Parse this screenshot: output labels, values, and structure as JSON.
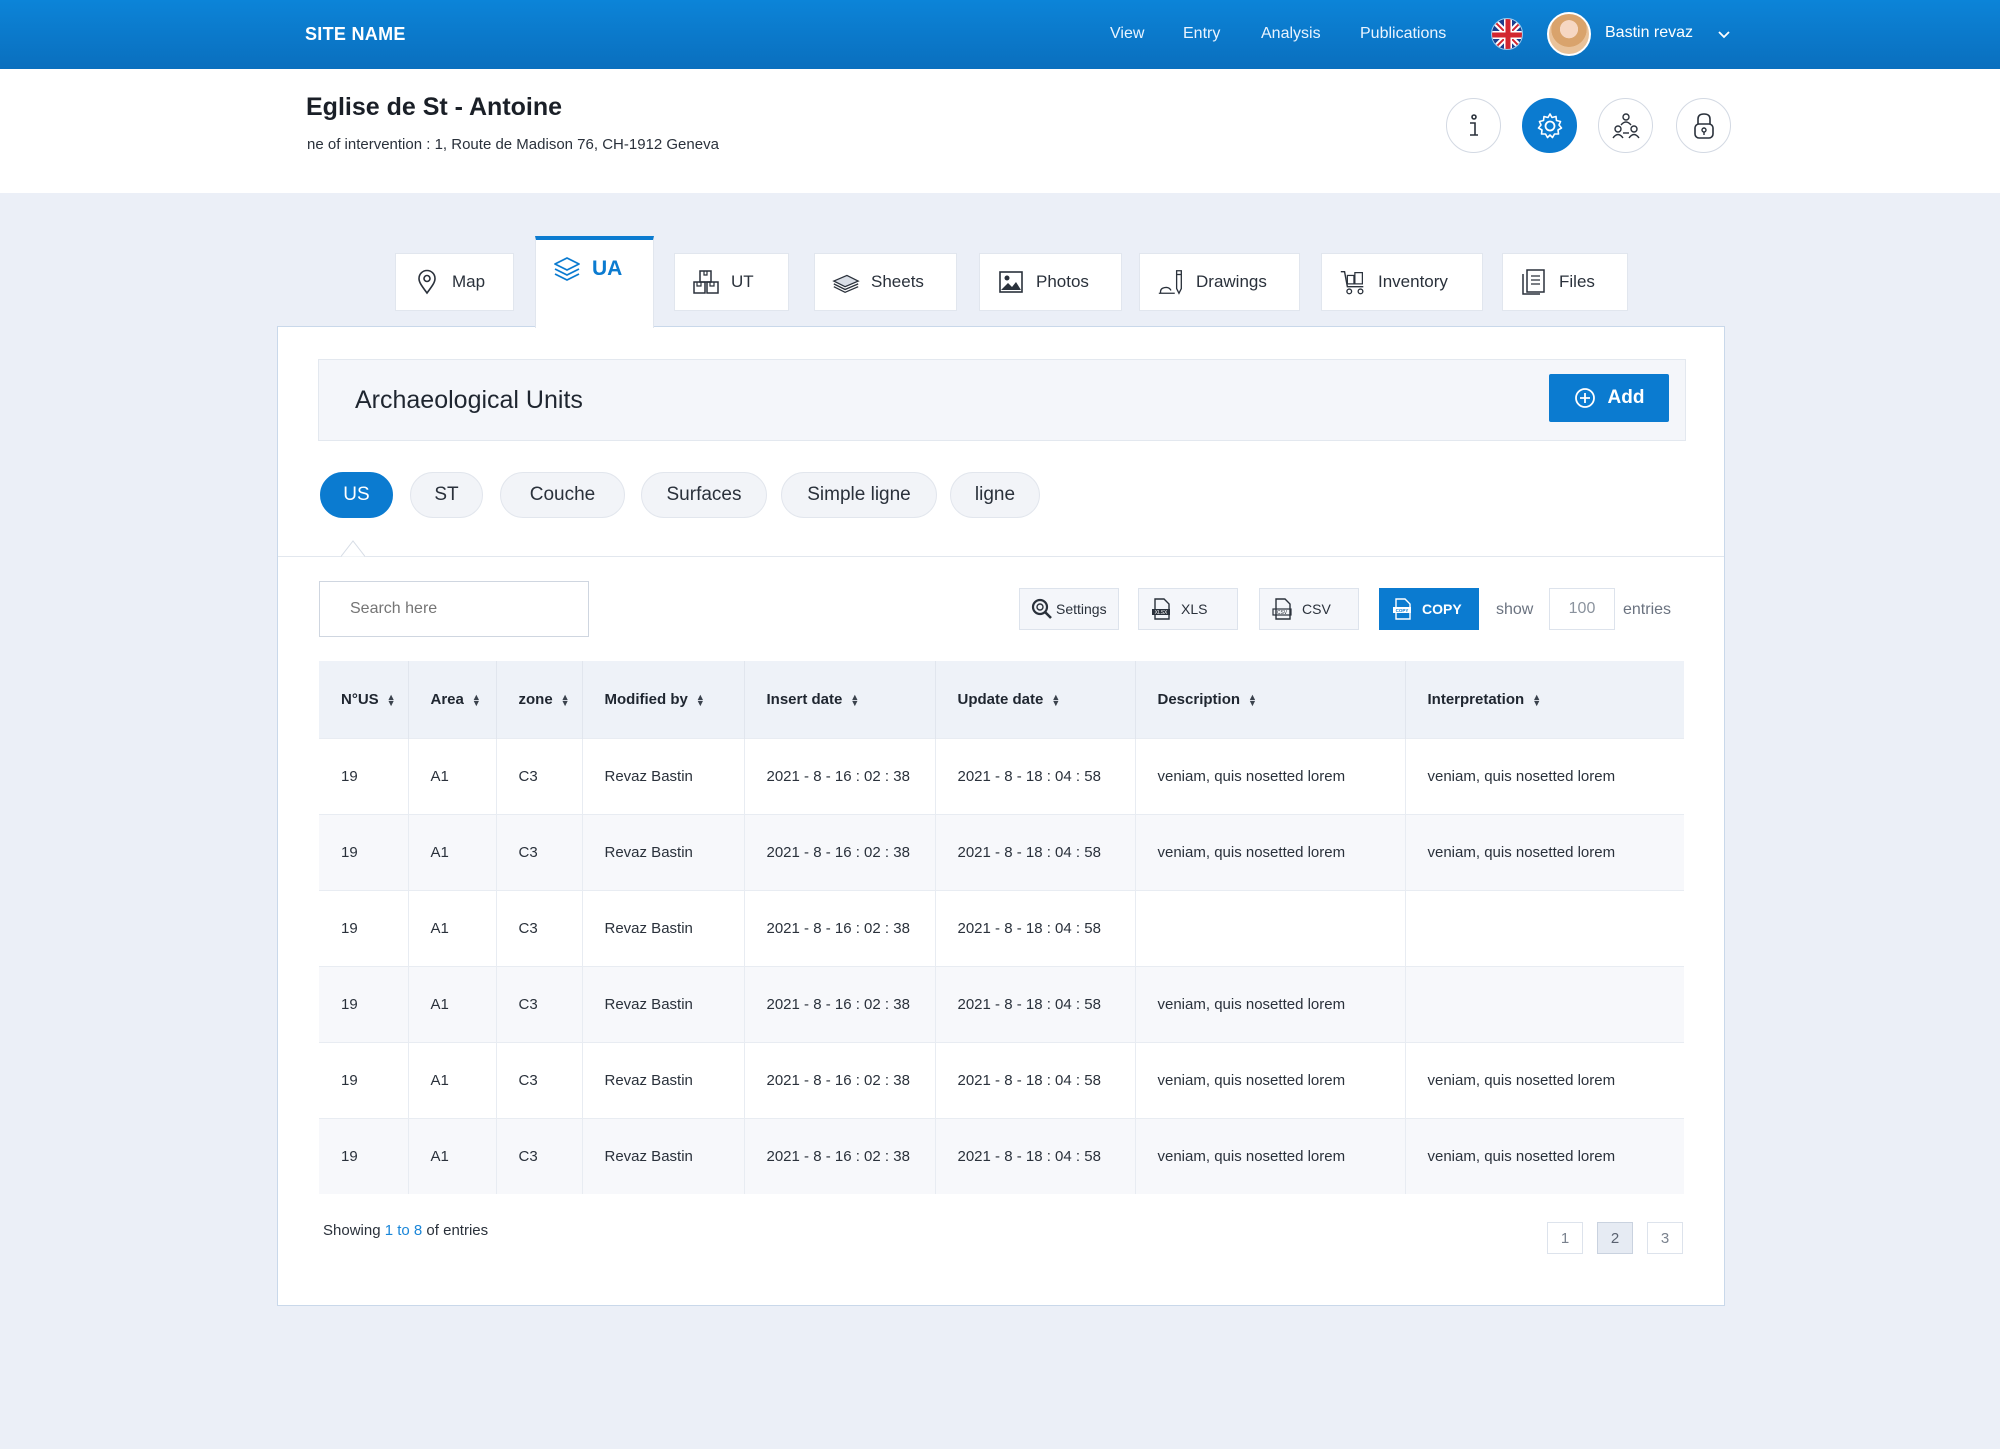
{
  "topbar": {
    "site_name": "SITE NAME",
    "nav": [
      "View",
      "Entry",
      "Analysis",
      "Publications"
    ],
    "user_name": "Bastin revaz",
    "brand_color": "#0b7bd0"
  },
  "header": {
    "title": "Eglise de St - Antoine",
    "address": "ne of intervention : 1, Route de Madison 76, CH-1912 Geneva",
    "icons": [
      "info-icon",
      "settings-gear-icon",
      "team-users-icon",
      "lock-icon"
    ],
    "active_icon": "settings-gear-icon"
  },
  "tabs": [
    {
      "label": "Map",
      "icon": "map-pin-icon"
    },
    {
      "label": "UA",
      "icon": "layers-icon",
      "active": true
    },
    {
      "label": "UT",
      "icon": "boxes-icon"
    },
    {
      "label": "Sheets",
      "icon": "sheets-stack-icon"
    },
    {
      "label": "Photos",
      "icon": "photo-icon"
    },
    {
      "label": "Drawings",
      "icon": "drawing-pencil-icon"
    },
    {
      "label": "Inventory",
      "icon": "cart-icon"
    },
    {
      "label": "Files",
      "icon": "files-icon"
    }
  ],
  "section": {
    "title": "Archaeological Units",
    "add_label": "Add"
  },
  "pills": [
    {
      "label": "US",
      "active": true
    },
    {
      "label": "ST"
    },
    {
      "label": "Couche"
    },
    {
      "label": "Surfaces"
    },
    {
      "label": "Simple ligne"
    },
    {
      "label": "ligne"
    }
  ],
  "toolbar": {
    "search_placeholder": "Search here",
    "settings_label": "Settings",
    "xls_label": "XLS",
    "csv_label": "CSV",
    "copy_label": "COPY",
    "show_label": "show",
    "entries_value": "100",
    "entries_label": "entries"
  },
  "table": {
    "columns": [
      "N°US",
      "Area",
      "zone",
      "Modified by",
      "Insert date",
      "Update date",
      "Description",
      "Interpretation"
    ],
    "rows": [
      [
        "19",
        "A1",
        "C3",
        "Revaz Bastin",
        "2021 - 8 - 16 : 02 : 38",
        "2021 - 8 - 18 : 04 : 58",
        "veniam, quis nosetted lorem",
        "veniam, quis nosetted lorem"
      ],
      [
        "19",
        "A1",
        "C3",
        "Revaz Bastin",
        "2021 - 8 - 16 : 02 : 38",
        "2021 - 8 - 18 : 04 : 58",
        "veniam, quis nosetted lorem",
        "veniam, quis nosetted lorem"
      ],
      [
        "19",
        "A1",
        "C3",
        "Revaz Bastin",
        "2021 - 8 - 16 : 02 : 38",
        "2021 - 8 - 18 : 04 : 58",
        "",
        ""
      ],
      [
        "19",
        "A1",
        "C3",
        "Revaz Bastin",
        "2021 - 8 - 16 : 02 : 38",
        "2021 - 8 - 18 : 04 : 58",
        "veniam, quis nosetted lorem",
        ""
      ],
      [
        "19",
        "A1",
        "C3",
        "Revaz Bastin",
        "2021 - 8 - 16 : 02 : 38",
        "2021 - 8 - 18 : 04 : 58",
        "veniam, quis nosetted lorem",
        "veniam, quis nosetted lorem"
      ],
      [
        "19",
        "A1",
        "C3",
        "Revaz Bastin",
        "2021 - 8 - 16 : 02 : 38",
        "2021 - 8 - 18 : 04 : 58",
        "veniam, quis nosetted lorem",
        "veniam, quis nosetted lorem"
      ]
    ]
  },
  "footer": {
    "showing_prefix": "Showing",
    "showing_range": "1 to 8",
    "showing_suffix": "of entries",
    "pages": [
      "1",
      "2",
      "3"
    ],
    "active_page": "2"
  }
}
